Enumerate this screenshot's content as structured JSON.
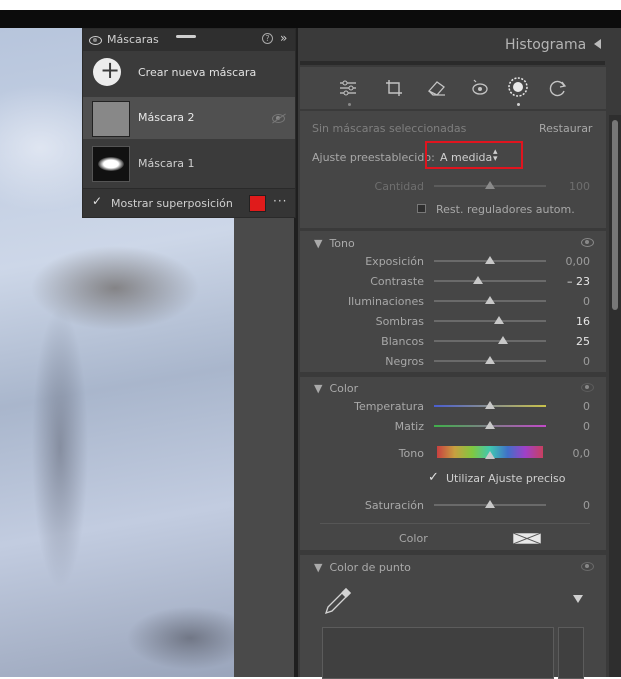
{
  "masks_panel": {
    "title": "Máscaras",
    "create_label": "Crear nueva máscara",
    "mask_items": [
      {
        "label": "Máscara 2"
      },
      {
        "label": "Máscara 1"
      }
    ],
    "show_overlay_label": "Mostrar superposición",
    "overlay_color": "#e01b1b"
  },
  "right_panel": {
    "histogram_label": "Histograma",
    "no_masks_label": "Sin máscaras seleccionadas",
    "reset_label": "Restaurar",
    "preset_label": "Ajuste preestablecido:",
    "preset_value": "A medida",
    "amount_label": "Cantidad",
    "amount_value": "100",
    "auto_reset_label": "Rest. reguladores autom.",
    "tono": {
      "title": "Tono",
      "sliders": [
        {
          "label": "Exposición",
          "value": "0,00",
          "position": 0.5
        },
        {
          "label": "Contraste",
          "value": "– 23",
          "position": 0.39
        },
        {
          "label": "Iluminaciones",
          "value": "0",
          "position": 0.5
        },
        {
          "label": "Sombras",
          "value": "16",
          "position": 0.58
        },
        {
          "label": "Blancos",
          "value": "25",
          "position": 0.62
        },
        {
          "label": "Negros",
          "value": "0",
          "position": 0.5
        }
      ]
    },
    "color": {
      "title": "Color",
      "temperatura_label": "Temperatura",
      "temperatura_value": "0",
      "matiz_label": "Matiz",
      "matiz_value": "0",
      "tono_label": "Tono",
      "tono_value": "0,0",
      "fine_adjust_label": "Utilizar Ajuste preciso",
      "saturacion_label": "Saturación",
      "saturacion_value": "0",
      "color_label": "Color"
    },
    "color_punto": {
      "title": "Color de punto"
    }
  },
  "colors": {
    "highlight_box": "#e0141e"
  }
}
